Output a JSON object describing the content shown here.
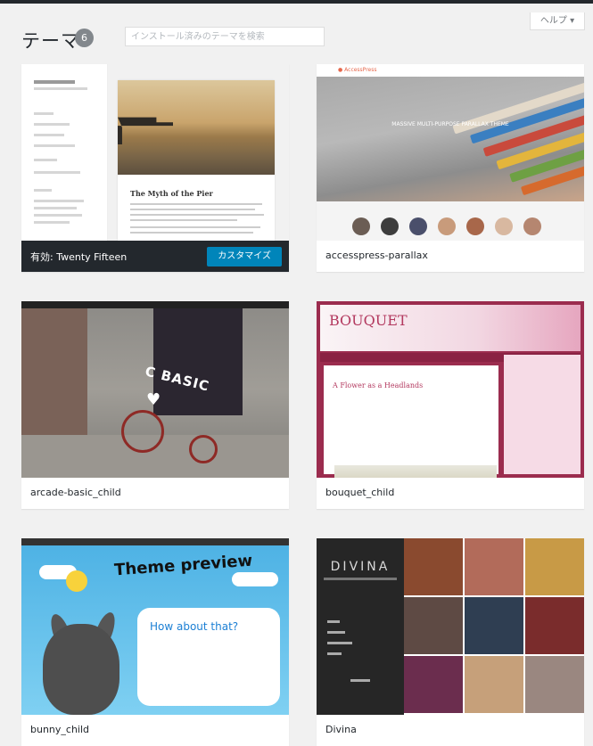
{
  "header": {
    "title": "テーマ",
    "count": "6",
    "search_placeholder": "インストール済みのテーマを検索",
    "help_label": "ヘルプ ▾"
  },
  "themes": [
    {
      "name": "有効: Twenty Fifteen",
      "active": true,
      "customize_label": "カスタマイズ",
      "preview": {
        "post_title": "The Myth of the Pier"
      }
    },
    {
      "name": "accesspress-parallax",
      "active": false,
      "preview": {
        "logo": "● AccessPress",
        "tagline": "MASSIVE MULTI-PURPOSE PARALLAX THEME"
      }
    },
    {
      "name": "arcade-basic_child",
      "active": false,
      "preview": {
        "sign": "C BASIC"
      }
    },
    {
      "name": "bouquet_child",
      "active": false,
      "preview": {
        "logo": "BOUQUET",
        "post_title": "A Flower as a Headlands"
      }
    },
    {
      "name": "bunny_child",
      "active": false,
      "preview": {
        "title": "Theme preview",
        "card_title": "How about that?"
      }
    },
    {
      "name": "Divina",
      "active": false,
      "preview": {
        "logo": "DIVINA"
      }
    }
  ],
  "colors": {
    "background": "#f1f1f1",
    "active_bar": "#23282d",
    "customize_button": "#0085ba"
  }
}
